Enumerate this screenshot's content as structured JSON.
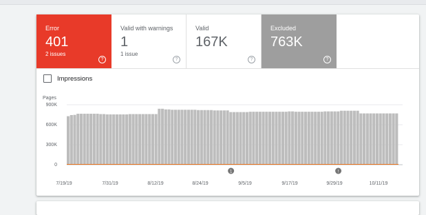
{
  "tiles": [
    {
      "key": "error",
      "label": "Error",
      "value": "401",
      "sub": "2 issues"
    },
    {
      "key": "warnings",
      "label": "Valid with warnings",
      "value": "1",
      "sub": "1 issue"
    },
    {
      "key": "valid",
      "label": "Valid",
      "value": "167K",
      "sub": ""
    },
    {
      "key": "excluded",
      "label": "Excluded",
      "value": "763K",
      "sub": ""
    }
  ],
  "help_glyph": "?",
  "impressions_label": "Impressions",
  "colors": {
    "error": "#e83a29",
    "excluded": "#9e9e9e",
    "bars": "#bdbdbd",
    "error_line": "#e8711a"
  },
  "chart_data": {
    "type": "bar",
    "ylabel": "Pages",
    "y_ticks": [
      "900K",
      "600K",
      "300K",
      "0"
    ],
    "ylim": [
      0,
      900000
    ],
    "x_tick_labels": [
      "7/19/19",
      "7/31/19",
      "8/12/19",
      "8/24/19",
      "9/5/19",
      "9/17/19",
      "9/29/19",
      "10/11/19"
    ],
    "annotation_markers": [
      {
        "index": 50,
        "glyph": "1"
      },
      {
        "index": 83,
        "glyph": "!"
      }
    ],
    "series": [
      {
        "values": [
          728000,
          745000,
          748000,
          765000,
          765000,
          765000,
          765000,
          765000,
          765000,
          765000,
          760000,
          760000,
          755000,
          755000,
          755000,
          755000,
          755000,
          755000,
          755000,
          760000,
          760000,
          760000,
          760000,
          760000,
          760000,
          760000,
          760000,
          760000,
          840000,
          840000,
          830000,
          830000,
          825000,
          825000,
          825000,
          825000,
          825000,
          825000,
          825000,
          825000,
          820000,
          820000,
          820000,
          820000,
          820000,
          815000,
          815000,
          815000,
          815000,
          815000,
          790000,
          790000,
          790000,
          790000,
          790000,
          790000,
          795000,
          795000,
          795000,
          795000,
          795000,
          795000,
          795000,
          795000,
          795000,
          795000,
          795000,
          795000,
          800000,
          800000,
          795000,
          795000,
          795000,
          795000,
          795000,
          795000,
          795000,
          795000,
          795000,
          800000,
          800000,
          800000,
          800000,
          800000,
          810000,
          810000,
          810000,
          810000,
          810000,
          810000,
          770000,
          770000,
          770000,
          770000,
          770000,
          770000,
          770000,
          770000,
          770000,
          770000,
          770000,
          770000
        ]
      },
      {
        "values": [
          401,
          401,
          401,
          401,
          401,
          401,
          401,
          401,
          401,
          401,
          401,
          401,
          401,
          401,
          401,
          401,
          401,
          401,
          401,
          401,
          401,
          401,
          401,
          401,
          401,
          401,
          401,
          401,
          401,
          401,
          401,
          401,
          401,
          401,
          401,
          401,
          401,
          401,
          401,
          401,
          401,
          401,
          401,
          401,
          401,
          401,
          401,
          401,
          401,
          401,
          401,
          401,
          401,
          401,
          401,
          401,
          401,
          401,
          401,
          401,
          401,
          401,
          401,
          401,
          401,
          401,
          401,
          401,
          401,
          401,
          401,
          401,
          401,
          401,
          401,
          401,
          401,
          401,
          401,
          401,
          401,
          401,
          401,
          401,
          401,
          401,
          401,
          401,
          401,
          401,
          401,
          401,
          401,
          401,
          401,
          401,
          401,
          401,
          401,
          401,
          401,
          401
        ]
      }
    ]
  }
}
